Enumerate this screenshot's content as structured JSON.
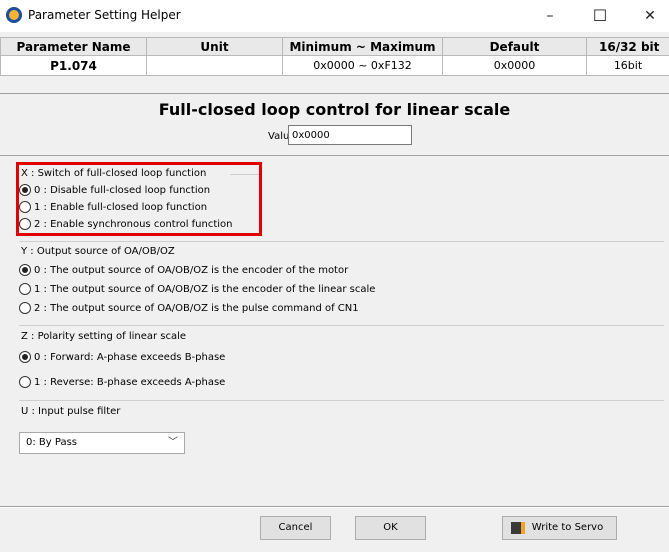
{
  "window": {
    "title": "Parameter Setting Helper",
    "minimize": "–",
    "maximize": "☐",
    "close": "✕"
  },
  "param_table": {
    "headers": [
      "Parameter Name",
      "Unit",
      "Minimum ~ Maximum",
      "Default",
      "16/32 bit"
    ],
    "row": [
      "P1.074",
      "",
      "0x0000 ~ 0xF132",
      "0x0000",
      "16bit"
    ]
  },
  "heading": "Full-closed loop control for linear scale",
  "value": {
    "label": "Value",
    "current": "0x0000"
  },
  "groups": {
    "x": {
      "label": "X : Switch of full-closed loop function",
      "options": [
        "0 : Disable full-closed loop function",
        "1 : Enable full-closed loop function",
        "2 : Enable synchronous control function"
      ],
      "selected": 0
    },
    "y": {
      "label": "Y : Output source of OA/OB/OZ",
      "options": [
        "0 : The output source of OA/OB/OZ is the encoder of the motor",
        "1 : The output source of OA/OB/OZ is the encoder of the linear scale",
        "2 : The output source of OA/OB/OZ is the pulse command of CN1"
      ],
      "selected": 0
    },
    "z": {
      "label": "Z : Polarity setting of linear scale",
      "options": [
        "0 : Forward: A-phase exceeds B-phase",
        "1 : Reverse: B-phase exceeds A-phase"
      ],
      "selected": 0
    },
    "u": {
      "label": "U : Input pulse filter",
      "selected_value": "0: By Pass"
    }
  },
  "buttons": {
    "cancel": "Cancel",
    "ok": "OK",
    "write": "Write to Servo"
  },
  "colors": {
    "highlight": "#e00000"
  }
}
